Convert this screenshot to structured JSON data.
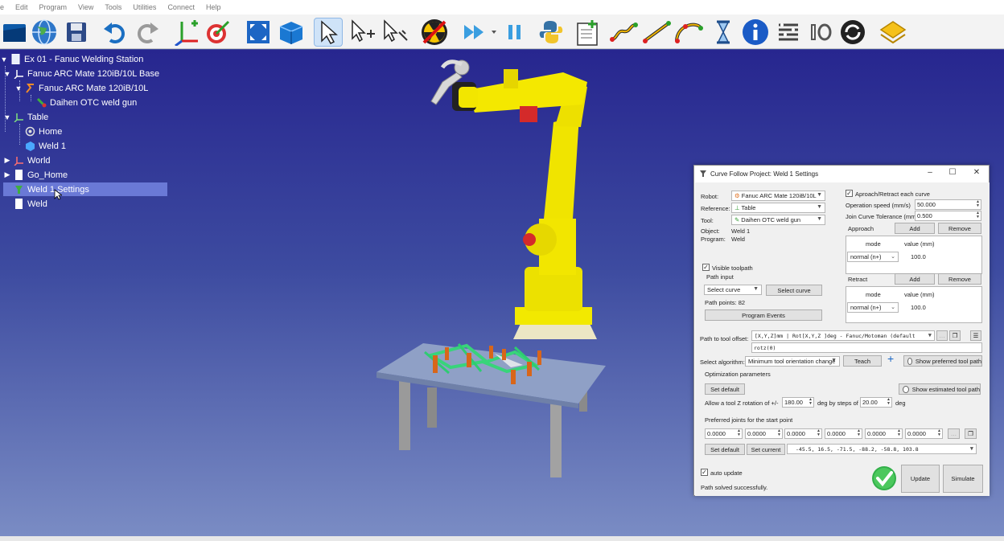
{
  "menu": {
    "items": [
      "e",
      "Edit",
      "Program",
      "View",
      "Tools",
      "Utilities",
      "Connect",
      "Help"
    ]
  },
  "toolbar": {
    "buttons": [
      "open-station",
      "world-globe",
      "save",
      "undo",
      "redo",
      "add-reference-frame",
      "add-target",
      "fit-all",
      "box-view",
      "select-pointer",
      "select-targets",
      "select-tool",
      "collision-check",
      "fast-forward",
      "pause",
      "python-script",
      "add-program",
      "move-joint",
      "move-linear",
      "move-circular",
      "pause-instruction",
      "message",
      "set-io",
      "io-wait",
      "program-call",
      "sync-reload"
    ]
  },
  "tree": {
    "items": [
      {
        "label": "Ex 01 - Fanuc Welding Station",
        "icon": "station-icon"
      },
      {
        "label": "Fanuc ARC Mate 120iB/10L Base",
        "icon": "frame-icon"
      },
      {
        "label": "Fanuc ARC Mate 120iB/10L",
        "icon": "robot-icon"
      },
      {
        "label": "Daihen OTC weld gun",
        "icon": "tool-icon"
      },
      {
        "label": "Table",
        "icon": "frame-icon"
      },
      {
        "label": "Home",
        "icon": "target-icon"
      },
      {
        "label": "Weld 1",
        "icon": "object-icon"
      },
      {
        "label": "World",
        "icon": "frame-icon"
      },
      {
        "label": "Go_Home",
        "icon": "program-icon"
      },
      {
        "label": "Weld 1 Settings",
        "icon": "curve-follow-icon"
      },
      {
        "label": "Weld",
        "icon": "program-icon"
      }
    ]
  },
  "dialog": {
    "title": "Curve Follow Project: Weld 1 Settings",
    "robot_label": "Robot:",
    "robot_value": "Fanuc ARC Mate 120iB/10L",
    "reference_label": "Reference:",
    "reference_value": "Table",
    "tool_label": "Tool:",
    "tool_value": "Daihen OTC weld gun",
    "object_label": "Object:",
    "object_value": "Weld 1",
    "program_label": "Program:",
    "program_value": "Weld",
    "approach_retract_label": "Aproach/Retract each curve",
    "operation_speed_label": "Operation speed (mm/s)",
    "operation_speed_value": "50.000",
    "join_tolerance_label": "Join Curve Tolerance (mm)",
    "join_tolerance_value": "0.500",
    "approach": {
      "label": "Approach",
      "add": "Add",
      "remove": "Remove",
      "mode_header": "mode",
      "value_header": "value (mm)",
      "mode_value": "normal (n+)",
      "value": "100.0"
    },
    "retract": {
      "label": "Retract",
      "add": "Add",
      "remove": "Remove",
      "mode_header": "mode",
      "value_header": "value (mm)",
      "mode_value": "normal (n+)",
      "value": "100.0"
    },
    "visible_toolpath_label": "Visible toolpath",
    "path_input_label": "Path input",
    "path_input_select": "Select curve",
    "select_curve_button": "Select curve",
    "path_points": "Path points: 82",
    "program_events_button": "Program Events",
    "tool_offset_label": "Path to tool offset:",
    "tool_offset_format": "[X,Y,Z]mm | Rot[X,Y,Z ]deg - Fanuc/Motoman (default",
    "tool_offset_value": "rotz(0)",
    "select_algorithm_label": "Select algorithm:",
    "algorithm_value": "Minimum tool orientation change",
    "teach_button": "Teach",
    "show_preferred_label": "Show preferred tool path",
    "optimization_label": "Optimization parameters",
    "set_default_button": "Set default",
    "show_estimated_label": "Show estimated tool path",
    "rotation_label": "Allow a tool Z rotation of +/-",
    "rotation_value": "180.00",
    "steps_label": "deg by steps of",
    "steps_value": "20.00",
    "deg_label": "deg",
    "preferred_joints_label": "Preferred joints for the start point",
    "joints": [
      "0.0000",
      "0.0000",
      "0.0000",
      "0.0000",
      "0.0000",
      "0.0000"
    ],
    "set_default2_button": "Set default",
    "set_current_button": "Set current",
    "current_joints": "-45.5,    16.5,    -71.5,    -88.2,    -58.8,   103.8",
    "auto_update_label": "auto update",
    "status": "Path solved successfully.",
    "update_button": "Update",
    "simulate_button": "Simulate"
  }
}
